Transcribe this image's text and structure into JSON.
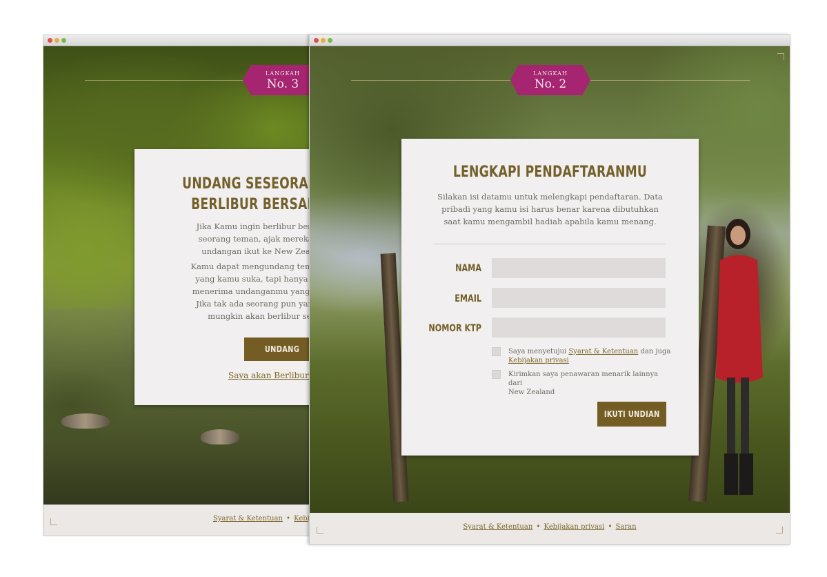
{
  "window_back": {
    "badge": {
      "label": "LANGKAH",
      "number": "No. 3"
    },
    "card": {
      "heading_line1": "UNDANG SESEORANG",
      "heading_line2": "BERLIBUR BERSAM",
      "para1_line1": "Jika Kamu ingin berlibur bersam",
      "para1_line2": "seorang teman, ajak mereka un",
      "para1_line3": "undangan ikut ke New Zealan",
      "para2_line1": "Kamu dapat mengundang teman se",
      "para2_line2": "yang kamu suka, tapi hanya oran",
      "para2_line3": "menerima undanganmu yang akan",
      "para2_line4": "Jika tak ada seorang pun yang m",
      "para2_line5": "mungkin akan berlibur sen",
      "button": "UNDANG TEMAN",
      "solo_link": "Saya akan Berlibur Sen"
    },
    "footer": {
      "terms": "Syarat & Ketentuan",
      "separator": "•",
      "privacy": "Kebijakan pri"
    }
  },
  "window_front": {
    "badge": {
      "label": "LANGKAH",
      "number": "No. 2"
    },
    "card": {
      "heading": "LENGKAPI PENDAFTARANMU",
      "intro_line1": "Silakan isi datamu untuk melengkapi pendaftaran. Data",
      "intro_line2": "pribadi yang kamu isi harus benar karena dibutuhkan",
      "intro_line3": "saat kamu mengambil hadiah apabila kamu menang.",
      "fields": [
        {
          "label": "NAMA",
          "value": ""
        },
        {
          "label": "EMAIL",
          "value": ""
        },
        {
          "label": "NOMOR KTP",
          "value": ""
        }
      ],
      "agree_prefix": "Saya menyetujui",
      "agree_terms_link": "Syarat & Ketentuan",
      "agree_middle": "dan juga",
      "agree_privacy_link": "Kebijakan privasi",
      "offers_line1": "Kirimkan saya penawaran menarik lainnya dari",
      "offers_line2": "New Zealand",
      "submit": "IKUTI UNDIAN"
    },
    "footer": {
      "terms": "Syarat & Ketentuan",
      "separator": "•",
      "privacy": "Kebijakan privasi",
      "separator2": "•",
      "feedback": "Saran"
    }
  },
  "colors": {
    "accent_gold": "#745d25",
    "badge_magenta": "#a52570",
    "card_bg": "#f1efef",
    "input_bg": "#dfdbdb"
  }
}
